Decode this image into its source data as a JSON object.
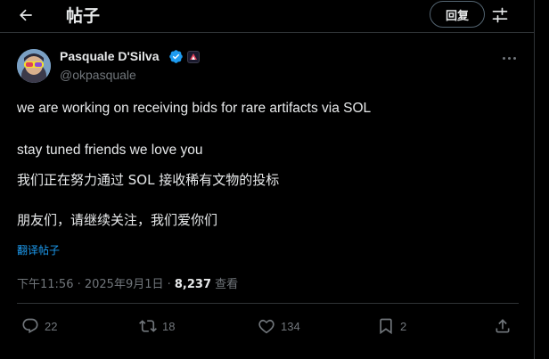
{
  "header": {
    "title": "帖子",
    "reply_label": "回复"
  },
  "author": {
    "name": "Pasquale D'Silva",
    "handle": "@okpasquale"
  },
  "tweet": {
    "lines": [
      "we are working on receiving bids for rare artifacts via SOL",
      "stay tuned friends we love you",
      "我们正在努力通过 SOL 接收稀有文物的投标",
      "朋友们，请继续关注，我们爱你们"
    ],
    "translate_label": "翻译帖子"
  },
  "meta": {
    "timestamp": "下午11:56 · 2025年9月1日 · ",
    "views": "8,237",
    "views_label": " 查看"
  },
  "actions": {
    "replies": "22",
    "reposts": "18",
    "likes": "134",
    "bookmarks": "2"
  },
  "icons": [
    "back-arrow-icon",
    "filter-icon",
    "verified-icon",
    "affiliate-badge-icon",
    "more-icon",
    "reply-icon",
    "repost-icon",
    "like-icon",
    "bookmark-icon",
    "share-icon"
  ],
  "colors": {
    "background": "#000000",
    "text": "#e7e9ea",
    "muted": "#71767b",
    "accent": "#1d9bf0",
    "border": "#2f3336"
  }
}
